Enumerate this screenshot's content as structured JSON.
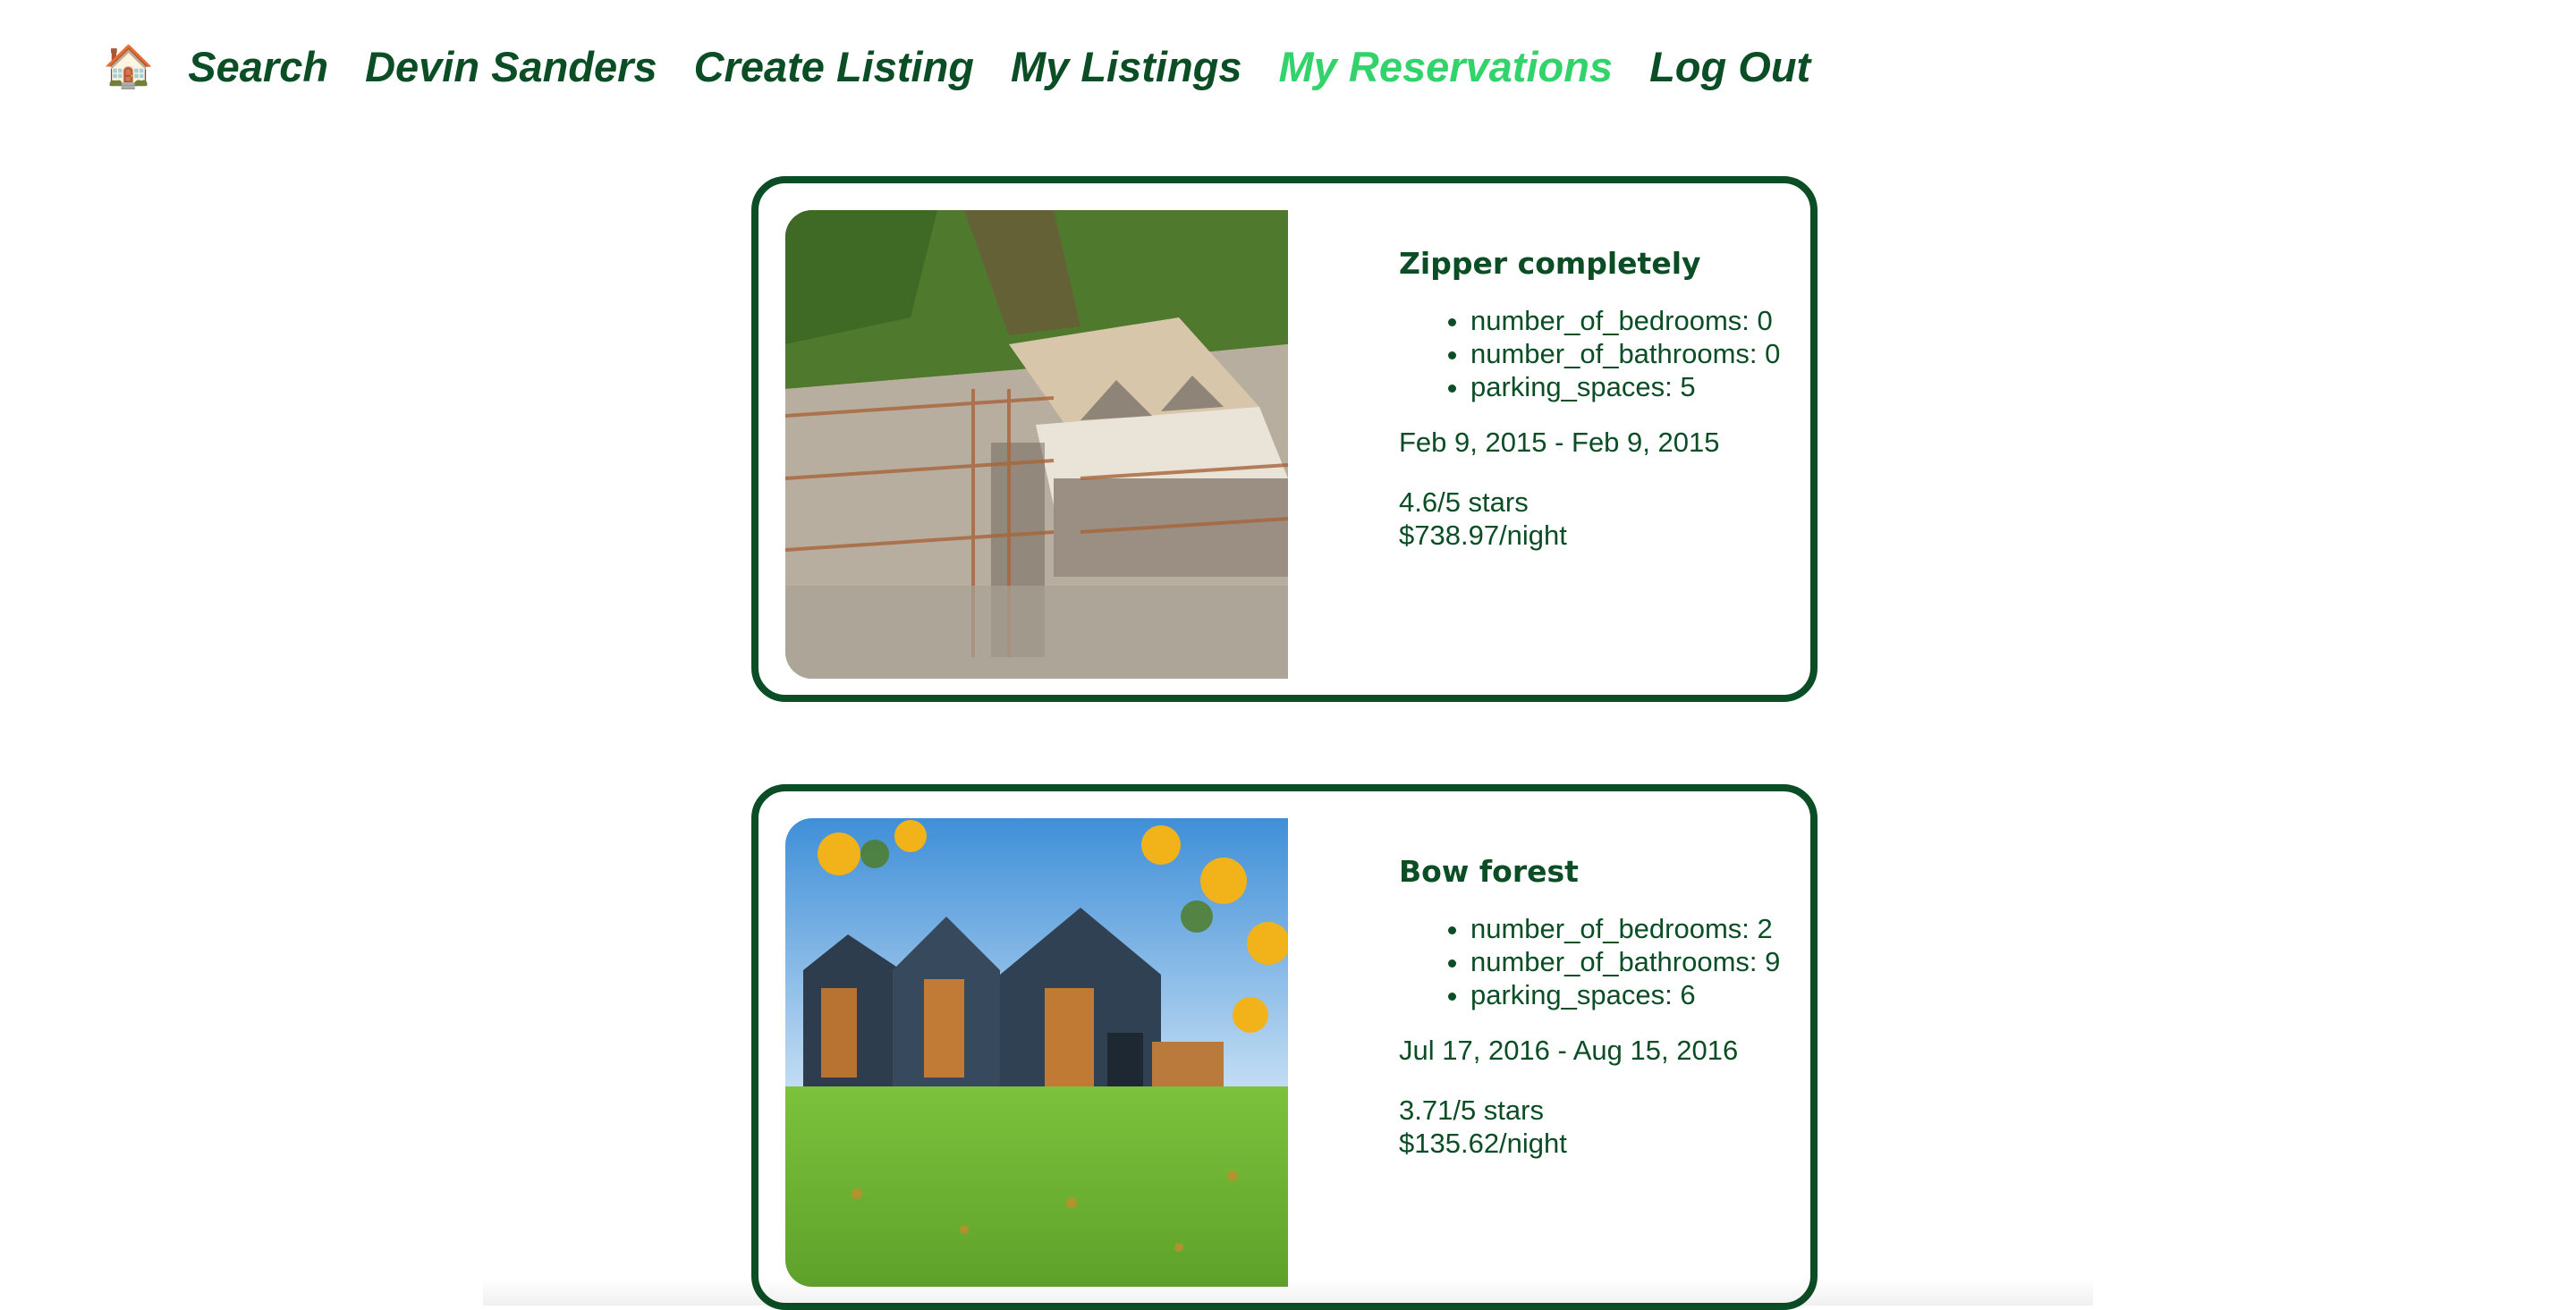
{
  "nav": {
    "home_icon": "🏠",
    "links": [
      {
        "label": "Search"
      },
      {
        "label": "Devin Sanders"
      },
      {
        "label": "Create Listing"
      },
      {
        "label": "My Listings"
      },
      {
        "label": "My Reservations",
        "active": true
      },
      {
        "label": "Log Out"
      }
    ]
  },
  "colors": {
    "primary": "#0b4d24",
    "active": "#33d36b"
  },
  "reservations": [
    {
      "title": "Zipper completely",
      "image": "house-under-construction-photo",
      "features": [
        "number_of_bedrooms: 0",
        "number_of_bathrooms: 0",
        "parking_spaces: 5"
      ],
      "dates": "Feb 9, 2015 - Feb 9, 2015",
      "rating": "4.6/5 stars",
      "price": "$738.97/night"
    },
    {
      "title": "Bow forest",
      "image": "modern-wooden-houses-photo",
      "features": [
        "number_of_bedrooms: 2",
        "number_of_bathrooms: 9",
        "parking_spaces: 6"
      ],
      "dates": "Jul 17, 2016 - Aug 15, 2016",
      "rating": "3.71/5 stars",
      "price": "$135.62/night"
    }
  ]
}
